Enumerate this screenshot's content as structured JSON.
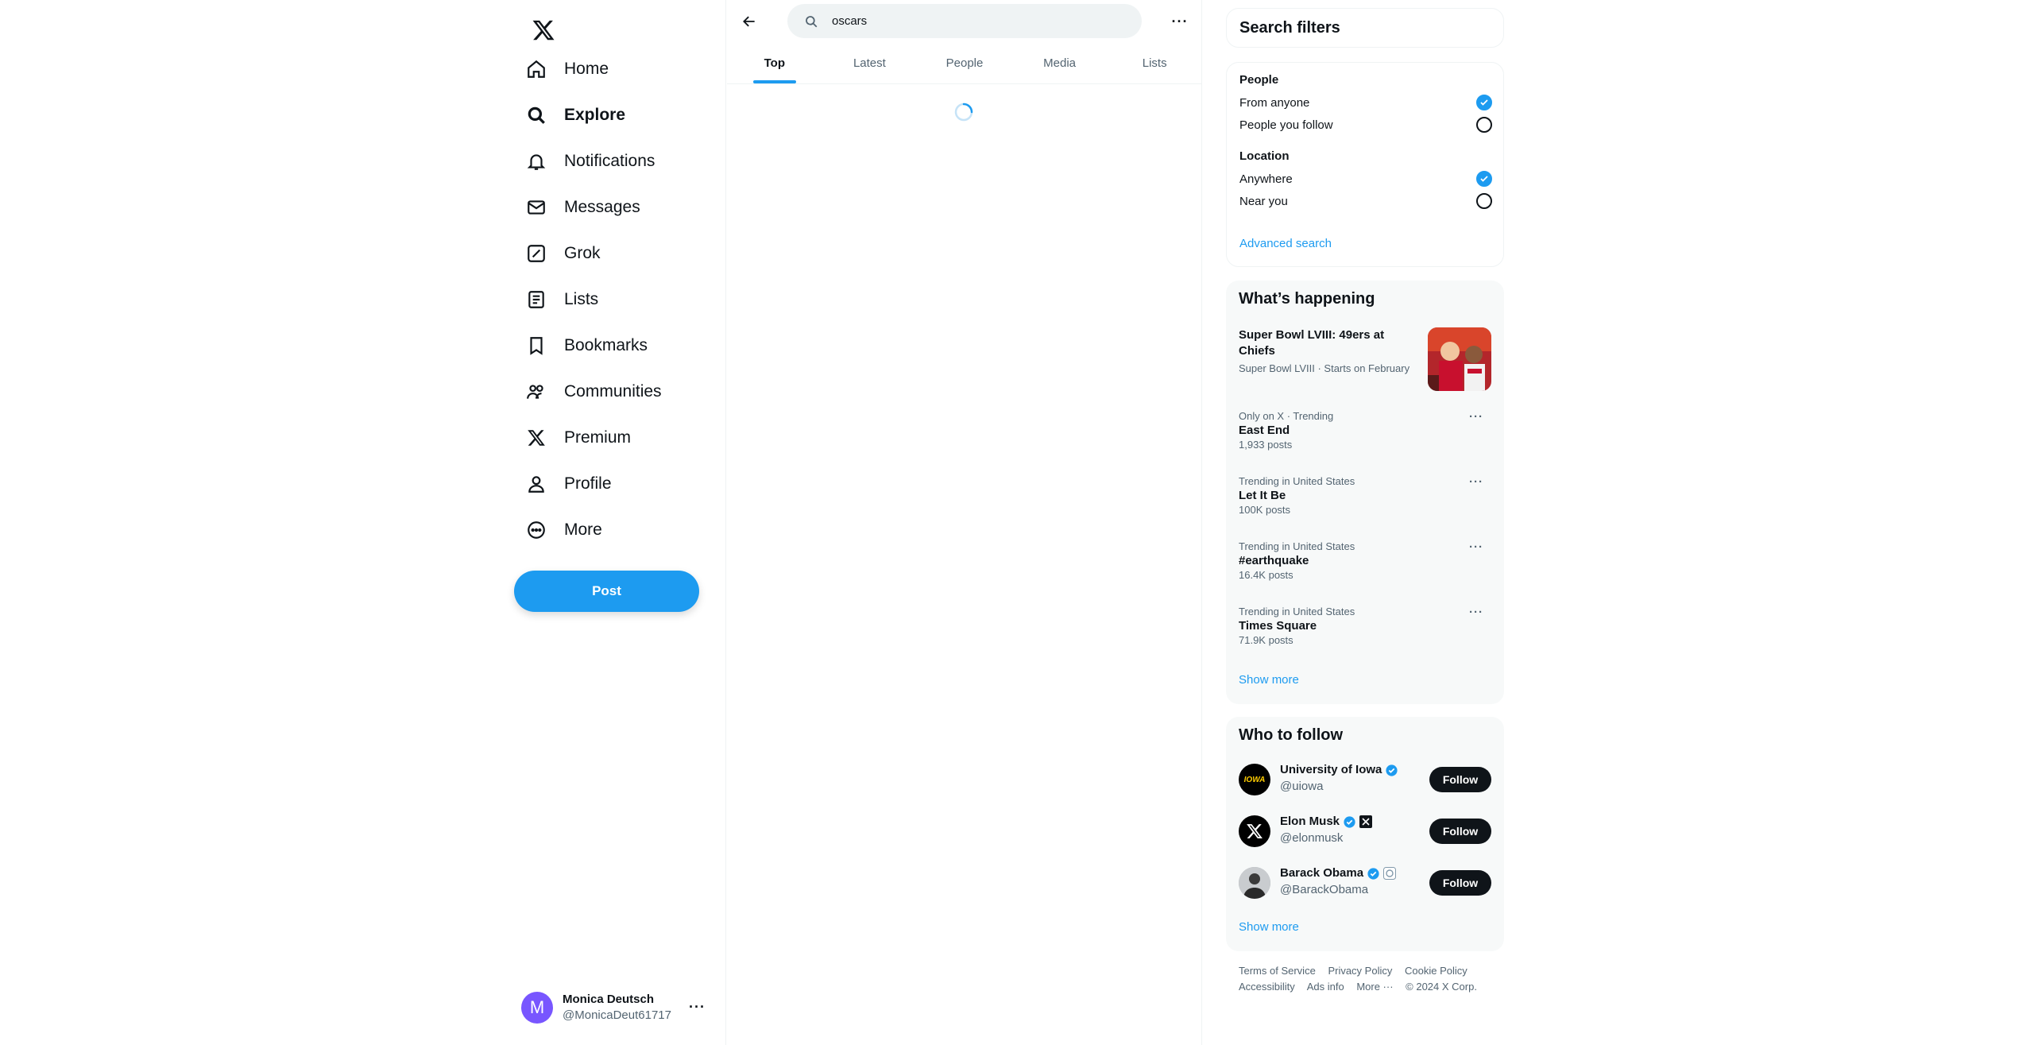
{
  "nav": {
    "items": [
      {
        "label": "Home",
        "icon": "home-icon"
      },
      {
        "label": "Explore",
        "icon": "search-icon",
        "active": true
      },
      {
        "label": "Notifications",
        "icon": "bell-icon"
      },
      {
        "label": "Messages",
        "icon": "envelope-icon"
      },
      {
        "label": "Grok",
        "icon": "grok-icon"
      },
      {
        "label": "Lists",
        "icon": "list-icon"
      },
      {
        "label": "Bookmarks",
        "icon": "bookmark-icon"
      },
      {
        "label": "Communities",
        "icon": "people-icon"
      },
      {
        "label": "Premium",
        "icon": "x-logo-icon"
      },
      {
        "label": "Profile",
        "icon": "person-icon"
      },
      {
        "label": "More",
        "icon": "more-circle-icon"
      }
    ],
    "post_label": "Post"
  },
  "account": {
    "initial": "M",
    "name": "Monica Deutsch",
    "handle": "@MonicaDeut61717",
    "avatar_color": "#7856ff"
  },
  "search": {
    "value": "oscars",
    "placeholder": "Search"
  },
  "tabs": [
    "Top",
    "Latest",
    "People",
    "Media",
    "Lists"
  ],
  "filters": {
    "title": "Search filters",
    "people_title": "People",
    "people_options": [
      {
        "label": "From anyone",
        "checked": true
      },
      {
        "label": "People you follow",
        "checked": false
      }
    ],
    "location_title": "Location",
    "location_options": [
      {
        "label": "Anywhere",
        "checked": true
      },
      {
        "label": "Near you",
        "checked": false
      }
    ],
    "advanced": "Advanced search"
  },
  "happening": {
    "title": "What’s happening",
    "featured": {
      "title": "Super Bowl LVIII: 49ers at Chiefs",
      "context": "Super Bowl LVIII · Starts on February"
    },
    "trends": [
      {
        "context": "Only on X · Trending",
        "title": "East End",
        "count": "1,933 posts"
      },
      {
        "context": "Trending in United States",
        "title": "Let It Be",
        "count": "100K posts"
      },
      {
        "context": "Trending in United States",
        "title": "#earthquake",
        "count": "16.4K posts"
      },
      {
        "context": "Trending in United States",
        "title": "Times Square",
        "count": "71.9K posts"
      }
    ],
    "show_more": "Show more"
  },
  "who_to_follow": {
    "title": "Who to follow",
    "accounts": [
      {
        "name": "University of Iowa",
        "handle": "@uiowa"
      },
      {
        "name": "Elon Musk",
        "handle": "@elonmusk"
      },
      {
        "name": "Barack Obama",
        "handle": "@BarackObama"
      }
    ],
    "follow_label": "Follow",
    "show_more": "Show more"
  },
  "footer": {
    "links": [
      "Terms of Service",
      "Privacy Policy",
      "Cookie Policy",
      "Accessibility",
      "Ads info",
      "More ···",
      "© 2024 X Corp."
    ]
  },
  "colors": {
    "accent": "#1d9bf0",
    "text": "#0f1419",
    "muted": "#536471",
    "card_bg": "#f7f9f9"
  }
}
